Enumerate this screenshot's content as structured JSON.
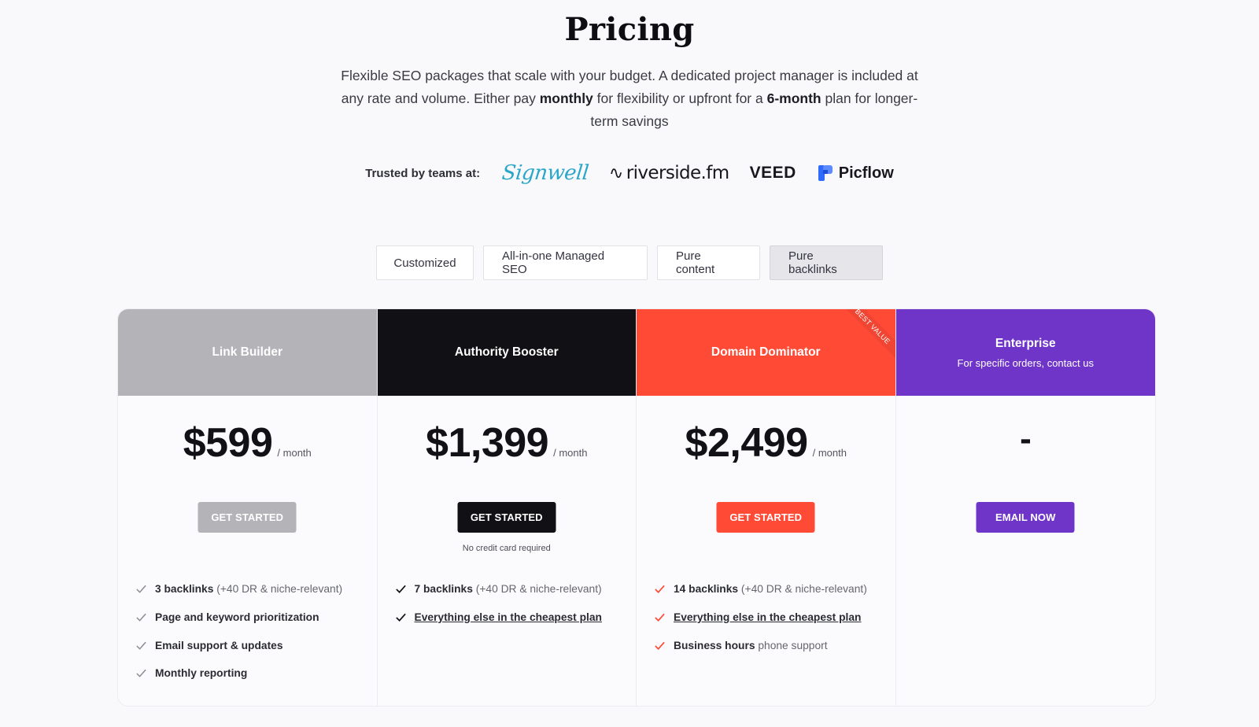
{
  "page": {
    "title": "Pricing",
    "subtitle_parts": [
      "Flexible SEO packages that scale with your budget. A dedicated project manager is included at any rate and volume. Either pay ",
      "monthly",
      " for flexibility or upfront for a ",
      "6-month",
      " plan for longer-term savings"
    ]
  },
  "trusted": {
    "label": "Trusted by teams at:",
    "logos": [
      {
        "name": "Signwell",
        "icon": "signwell-logo"
      },
      {
        "name": "riverside.fm",
        "icon": "riverside-wave-logo"
      },
      {
        "name": "VEED",
        "icon": "veed-logo"
      },
      {
        "name": "Picflow",
        "icon": "picflow-logo",
        "color": "#2f6bff"
      }
    ]
  },
  "tabs": [
    {
      "label": "Customized",
      "active": false
    },
    {
      "label": "All-in-one Managed SEO",
      "active": false
    },
    {
      "label": "Pure content",
      "active": false
    },
    {
      "label": "Pure backlinks",
      "active": true
    }
  ],
  "plans": [
    {
      "name": "Link Builder",
      "subtitle": "",
      "header_color": "#b3b3b8",
      "price": "$599",
      "period": "/ month",
      "cta": "Get started",
      "cta_color": "#b3b3b8",
      "note": "",
      "check_color": "#8a8a92",
      "features": [
        {
          "bold": "3 backlinks",
          "rest": " (+40 DR & niche-relevant)",
          "link": false
        },
        {
          "bold": "Page and keyword prioritization",
          "rest": "",
          "link": false
        },
        {
          "bold": "Email support & updates",
          "rest": "",
          "link": false
        },
        {
          "bold": "Monthly reporting",
          "rest": "",
          "link": false
        }
      ]
    },
    {
      "name": "Authority Booster",
      "subtitle": "",
      "header_color": "#111115",
      "price": "$1,399",
      "period": "/ month",
      "cta": "Get started",
      "cta_color": "#111115",
      "note": "No credit card required",
      "check_color": "#111115",
      "features": [
        {
          "bold": "7 backlinks",
          "rest": " (+40 DR & niche-relevant)",
          "link": false
        },
        {
          "bold": "Everything else in the cheapest plan",
          "rest": "",
          "link": true
        }
      ]
    },
    {
      "name": "Domain Dominator",
      "subtitle": "",
      "ribbon": "Best value",
      "header_color": "#ff4a36",
      "price": "$2,499",
      "period": "/ month",
      "cta": "Get started",
      "cta_color": "#ff4a36",
      "note": "",
      "check_color": "#ff4a36",
      "features": [
        {
          "bold": "14 backlinks",
          "rest": " (+40 DR & niche-relevant)",
          "link": false
        },
        {
          "bold": "Everything else in the cheapest plan",
          "rest": "",
          "link": true
        },
        {
          "bold": "Business hours",
          "rest": " phone support",
          "link": false
        }
      ]
    },
    {
      "name": "Enterprise",
      "subtitle": "For specific orders, contact us",
      "header_color": "#6f35c9",
      "price": "-",
      "period": "",
      "cta": "Email now",
      "cta_color": "#6f35c9",
      "note": "",
      "check_color": "#6f35c9",
      "features": []
    }
  ]
}
